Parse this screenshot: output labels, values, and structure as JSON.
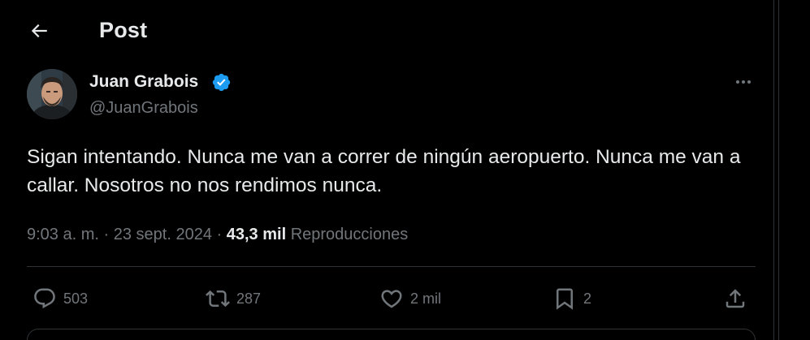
{
  "header": {
    "title": "Post",
    "back_icon": "arrow-left-icon"
  },
  "author": {
    "name": "Juan Grabois",
    "handle": "@JuanGrabois",
    "verified": true,
    "verified_color": "#1d9bf0"
  },
  "post": {
    "text": "Sigan intentando. Nunca me van a correr de ningún aeropuerto. Nunca me van a callar. Nosotros no nos rendimos nunca.",
    "time": "9:03 a. m.",
    "date": "23 sept. 2024",
    "separator": "·",
    "views_count": "43,3 mil",
    "views_label": "Reproducciones"
  },
  "actions": {
    "replies": "503",
    "reposts": "287",
    "likes": "2 mil",
    "bookmarks": "2"
  },
  "colors": {
    "background": "#000000",
    "text_primary": "#e7e9ea",
    "text_secondary": "#71767b",
    "border": "#2f3336"
  }
}
